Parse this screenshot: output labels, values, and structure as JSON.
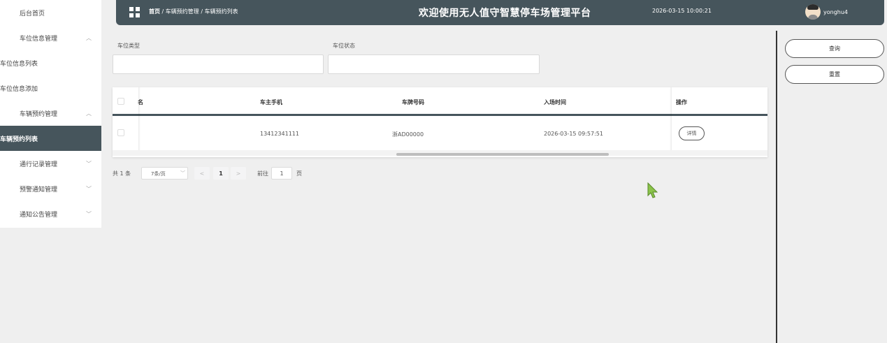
{
  "sidebar": {
    "items": [
      {
        "label": "后台首页",
        "chevron": ""
      },
      {
        "label": "车位信息管理",
        "chevron": "^"
      },
      {
        "label": "车位信息列表",
        "chevron": ""
      },
      {
        "label": "车位信息添加",
        "chevron": ""
      },
      {
        "label": "车辆预约管理",
        "chevron": "^"
      },
      {
        "label": "车辆预约列表",
        "chevron": ""
      },
      {
        "label": "通行记录管理",
        "chevron": "v"
      },
      {
        "label": "预警通知管理",
        "chevron": "v"
      },
      {
        "label": "通知公告管理",
        "chevron": "v"
      }
    ],
    "active_item": "车辆预约列表"
  },
  "header": {
    "breadcrumb": {
      "home": "首页",
      "sep": "/",
      "level1": "车辆预约管理",
      "level2": "车辆预约列表"
    },
    "title": "欢迎使用无人值守智慧停车场管理平台",
    "datetime": "2026-03-15 10:00:21",
    "username": "yonghu4"
  },
  "search": {
    "field1_label": "车位类型",
    "field1_value": "",
    "field2_label": "车位状态",
    "field2_value": "",
    "query_button": "查询",
    "reset_button": "重置"
  },
  "table": {
    "columns": {
      "name_partial": "名",
      "phone": "车主手机",
      "plate": "车牌号码",
      "entry_time": "入场时间",
      "action": "操作"
    },
    "rows": [
      {
        "phone": "13412341111",
        "plate": "浙AD00000",
        "entry_time": "2026-03-15 09:57:51",
        "action": "详情"
      }
    ]
  },
  "pagination": {
    "total": "共 1 条",
    "page_size": "7条/页",
    "prev": "<",
    "current_page": "1",
    "next": ">",
    "goto_label": "前往",
    "goto_value": "1",
    "page_suffix": "页"
  },
  "colors": {
    "primary": "#46555c",
    "cursor": "#8bc34a"
  }
}
